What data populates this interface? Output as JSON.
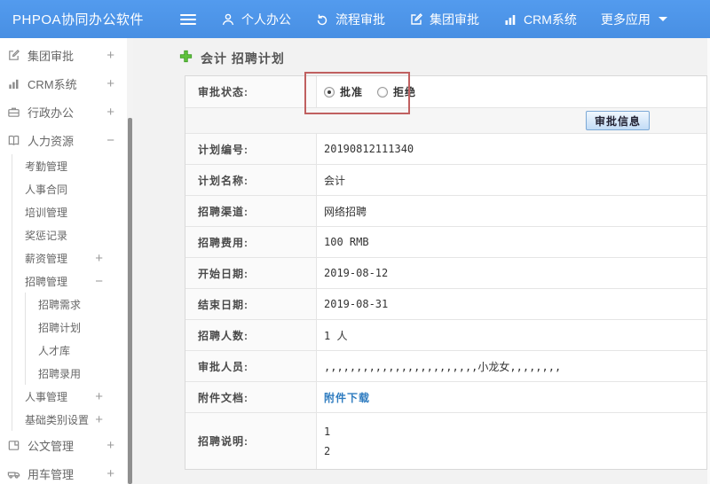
{
  "topbar": {
    "logo": "PHPOA协同办公软件",
    "nav": [
      {
        "label": "个人办公",
        "icon": "user-icon"
      },
      {
        "label": "流程审批",
        "icon": "flow-icon"
      },
      {
        "label": "集团审批",
        "icon": "edit-icon"
      },
      {
        "label": "CRM系统",
        "icon": "chart-icon"
      },
      {
        "label": "更多应用",
        "icon": "caret-down-icon"
      }
    ]
  },
  "sidebar": {
    "items": [
      {
        "label": "集团审批",
        "level": 1,
        "icon": "edit-icon",
        "toggle": "+"
      },
      {
        "label": "CRM系统",
        "level": 1,
        "icon": "chart-icon",
        "toggle": "+"
      },
      {
        "label": "行政办公",
        "level": 1,
        "icon": "briefcase-icon",
        "toggle": "+"
      },
      {
        "label": "人力资源",
        "level": 1,
        "icon": "book-icon",
        "toggle": "−"
      },
      {
        "label": "考勤管理",
        "level": 2,
        "toggle": ""
      },
      {
        "label": "人事合同",
        "level": 2,
        "toggle": ""
      },
      {
        "label": "培训管理",
        "level": 2,
        "toggle": ""
      },
      {
        "label": "奖惩记录",
        "level": 2,
        "toggle": ""
      },
      {
        "label": "薪资管理",
        "level": 2,
        "toggle": "+"
      },
      {
        "label": "招聘管理",
        "level": 2,
        "toggle": "−"
      },
      {
        "label": "招聘需求",
        "level": 3,
        "toggle": ""
      },
      {
        "label": "招聘计划",
        "level": 3,
        "toggle": ""
      },
      {
        "label": "人才库",
        "level": 3,
        "toggle": ""
      },
      {
        "label": "招聘录用",
        "level": 3,
        "toggle": ""
      },
      {
        "label": "人事管理",
        "level": 2,
        "toggle": "+"
      },
      {
        "label": "基础类别设置",
        "level": 2,
        "toggle": "+"
      },
      {
        "label": "公文管理",
        "level": 1,
        "icon": "document-icon",
        "toggle": "+"
      },
      {
        "label": "用车管理",
        "level": 1,
        "icon": "car-icon",
        "toggle": "+"
      }
    ]
  },
  "main": {
    "title": "会计 招聘计划",
    "approve_button": "审批信息",
    "status_row": {
      "label": "审批状态:",
      "options": [
        {
          "label": "批准",
          "checked": true
        },
        {
          "label": "拒绝",
          "checked": false
        }
      ]
    },
    "rows": [
      {
        "label": "计划编号:",
        "value": "20190812111340"
      },
      {
        "label": "计划名称:",
        "value": "会计"
      },
      {
        "label": "招聘渠道:",
        "value": "网络招聘"
      },
      {
        "label": "招聘费用:",
        "value": "100 RMB"
      },
      {
        "label": "开始日期:",
        "value": "2019-08-12"
      },
      {
        "label": "结束日期:",
        "value": "2019-08-31"
      },
      {
        "label": "招聘人数:",
        "value": "1 人"
      },
      {
        "label": "审批人员:",
        "value": ",,,,,,,,,,,,,,,,,,,,,,,,小龙女,,,,,,,,"
      },
      {
        "label": "附件文档:",
        "value": "附件下载"
      },
      {
        "label": "招聘说明:",
        "value_lines": [
          "1",
          "2"
        ]
      }
    ]
  },
  "colors": {
    "topbar_blue": "#4d96e9",
    "highlight_red": "#c06060",
    "link_blue": "#2f7cc0",
    "button_border_blue": "#7ca9d6",
    "plus_green": "#55b235",
    "page_bg": "#f2f2f2"
  }
}
